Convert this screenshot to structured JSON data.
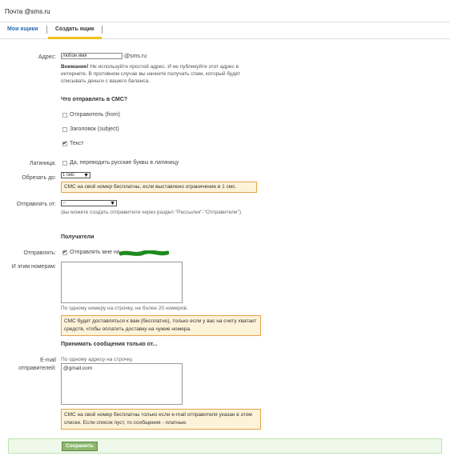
{
  "header": {
    "title": "Почта @sms.ru"
  },
  "tabs": [
    {
      "label": "Мои ящики"
    },
    {
      "label": "Создать ящик"
    }
  ],
  "form": {
    "address": {
      "label": "Адрес:",
      "value": "любое имя",
      "suffix": "@sms.ru",
      "warning_bold": "Внимание!",
      "warning_text": " Не используйте простой адрес. И не публикуйте этот адрес в интернете. В противном случае вы начнете получать спам, который будет списывать деньги с вашего баланса."
    },
    "send_in_sms": {
      "heading": "Что отправлять в СМС?",
      "options": [
        {
          "label": "Отправитель (from)",
          "checked": false
        },
        {
          "label": "Заголовок (subject)",
          "checked": false
        },
        {
          "label": "Текст",
          "checked": true
        }
      ]
    },
    "latin": {
      "label": "Латиница:",
      "option": "Да, переводить русские буквы в латиницу",
      "checked": false
    },
    "cut_to": {
      "label": "Обрезать до:",
      "value": "1 смс",
      "note": "СМС на свой номер бесплатны, если выставлено ограничение в 1 смс."
    },
    "send_from": {
      "label": "Отправлять от:",
      "value": "--",
      "help": "(вы можете создать отправителя через раздел \"Рассылки\"-\"Отправители\")"
    },
    "recipients": {
      "heading": "Получатели",
      "send_label": "Отправлять:",
      "send_option": "Отправлять мне на",
      "send_checked": true,
      "numbers_label": "И этим номерам:",
      "numbers_help": "По одному номеру на строчку, не более 20 номеров.",
      "numbers_note": "СМС будет доставляться к вам (бесплатно), только если у вас на счету хватает средств, чтобы оплатить доставку на чужие номера."
    },
    "accept": {
      "heading": "Принимать сообщения только от...",
      "email_label_1": "E-mail",
      "email_label_2": "отправителей:",
      "email_help": "По одному адресу на строчку.",
      "email_value": "@gmail.com",
      "email_note": "СМС на свой номер бесплатны только если e-mail отправителя указан в этом списке. Если список пуст, то сообщения - платные."
    },
    "save_label": "Сохранить"
  },
  "colors": {
    "tab_active_underline": "#f0c31a",
    "link_blue": "#2a6db0",
    "warning_bg": "#fdf3d9",
    "warning_border": "#e6a24a",
    "save_bar_bg": "#eef9ea",
    "save_button": "#8cb86e",
    "redaction_green": "#1e8a1e"
  }
}
